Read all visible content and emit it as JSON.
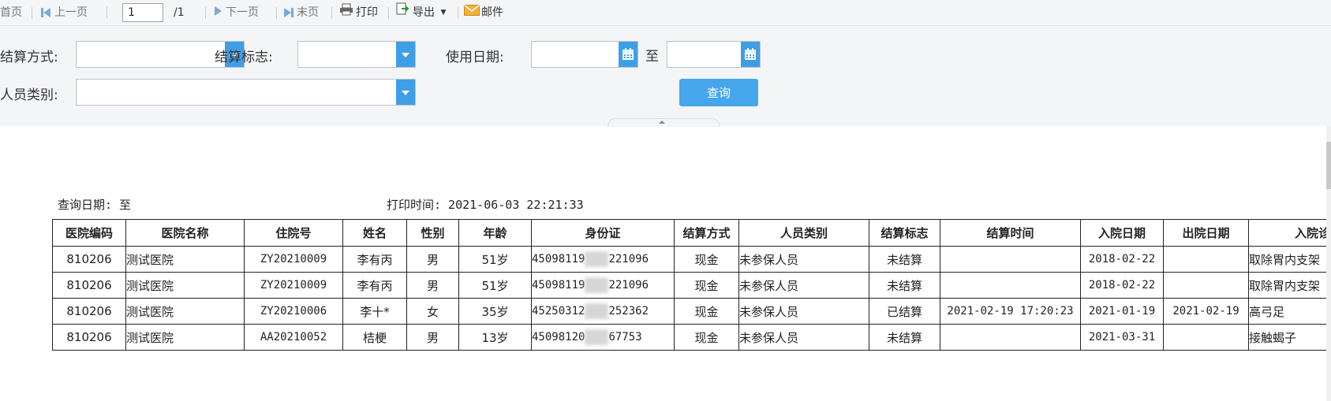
{
  "toolbar": {
    "first_page": "首页",
    "prev_page": "上一页",
    "page_value": "1",
    "page_total": "/1",
    "next_page": "下一页",
    "last_page": "末页",
    "print": "打印",
    "export": "导出",
    "mail": "邮件"
  },
  "filters": {
    "settle_method_label": "结算方式:",
    "settle_flag_label": "结算标志:",
    "use_date_label": "使用日期:",
    "to_label": "至",
    "person_type_label": "人员类别:",
    "query_button": "查询"
  },
  "report": {
    "query_date_label": "查询日期: 至",
    "print_time_label": "打印时间: 2021-06-03 22:21:33",
    "columns": [
      "医院编码",
      "医院名称",
      "住院号",
      "姓名",
      "性别",
      "年龄",
      "身份证",
      "结算方式",
      "人员类别",
      "结算标志",
      "结算时间",
      "入院日期",
      "出院日期",
      "入院诊"
    ],
    "rows": [
      {
        "code": "810206",
        "hospital": "测试医院",
        "inpatient_no": "ZY20210009",
        "name": "李有丙",
        "gender": "男",
        "age": "51岁",
        "id_prefix": "45098119",
        "id_suffix": "221096",
        "settle_method": "现金",
        "person_type": "未参保人员",
        "settle_flag": "未结算",
        "settle_time": "",
        "admit_date": "2018-02-22",
        "discharge_date": "",
        "diagnosis": "取除胃内支架"
      },
      {
        "code": "810206",
        "hospital": "测试医院",
        "inpatient_no": "ZY20210009",
        "name": "李有丙",
        "gender": "男",
        "age": "51岁",
        "id_prefix": "45098119",
        "id_suffix": "221096",
        "settle_method": "现金",
        "person_type": "未参保人员",
        "settle_flag": "未结算",
        "settle_time": "",
        "admit_date": "2018-02-22",
        "discharge_date": "",
        "diagnosis": "取除胃内支架"
      },
      {
        "code": "810206",
        "hospital": "测试医院",
        "inpatient_no": "ZY20210006",
        "name": "李十*",
        "gender": "女",
        "age": "35岁",
        "id_prefix": "45250312",
        "id_suffix": "252362",
        "settle_method": "现金",
        "person_type": "未参保人员",
        "settle_flag": "已结算",
        "settle_time": "2021-02-19 17:20:23",
        "admit_date": "2021-01-19",
        "discharge_date": "2021-02-19",
        "diagnosis": "高弓足"
      },
      {
        "code": "810206",
        "hospital": "测试医院",
        "inpatient_no": "AA20210052",
        "name": "桔梗",
        "gender": "男",
        "age": "13岁",
        "id_prefix": "45098120",
        "id_suffix": "67753",
        "settle_method": "现金",
        "person_type": "未参保人员",
        "settle_flag": "未结算",
        "settle_time": "",
        "admit_date": "2021-03-31",
        "discharge_date": "",
        "diagnosis": "接触蝎子"
      }
    ]
  },
  "colors": {
    "accent": "#46a6ec",
    "toolbar_bg": "#f4f5f7",
    "dropdown_blue": "#3f9ee8"
  },
  "icons": [
    "triangle-left-bar-icon",
    "triangle-left-icon",
    "triangle-right-icon",
    "triangle-right-bar-icon",
    "printer-icon",
    "export-icon",
    "chevron-down-icon",
    "mail-icon",
    "calendar-icon"
  ]
}
